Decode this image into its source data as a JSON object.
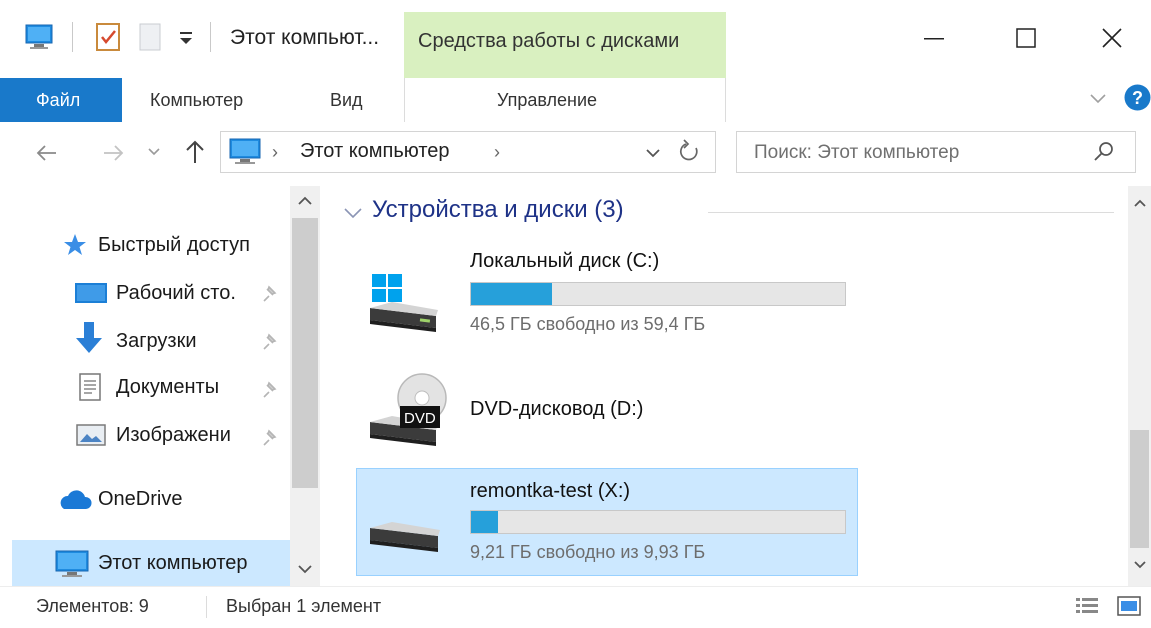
{
  "window": {
    "title": "Этот компьют...",
    "context_tab_title": "Средства работы с дисками"
  },
  "ribbon": {
    "tabs": [
      {
        "label": "Файл",
        "active": true
      },
      {
        "label": "Компьютер"
      },
      {
        "label": "Вид"
      },
      {
        "label": "Управление"
      }
    ]
  },
  "address": {
    "location": "Этот компьютер",
    "search_placeholder": "Поиск: Этот компьютер"
  },
  "nav": {
    "items": [
      {
        "label": "Быстрый доступ",
        "icon": "star-icon"
      },
      {
        "label": "Рабочий сто.",
        "icon": "desktop-icon",
        "pinned": true
      },
      {
        "label": "Загрузки",
        "icon": "download-arrow-icon",
        "pinned": true
      },
      {
        "label": "Документы",
        "icon": "document-icon",
        "pinned": true
      },
      {
        "label": "Изображени",
        "icon": "pictures-icon",
        "pinned": true
      },
      {
        "label": "OneDrive",
        "icon": "cloud-icon"
      },
      {
        "label": "Этот компьютер",
        "icon": "computer-icon",
        "selected": true
      }
    ]
  },
  "content": {
    "group_header": "Устройства и диски (3)",
    "drives": [
      {
        "name": "Локальный диск (C:)",
        "free_text": "46,5 ГБ свободно из 59,4 ГБ",
        "used_fraction": 0.217,
        "icon": "windows-drive-icon"
      },
      {
        "name": "DVD-дисковод (D:)",
        "icon": "dvd-drive-icon",
        "dvd_label": "DVD"
      },
      {
        "name": "remontka-test (X:)",
        "free_text": "9,21 ГБ свободно из 9,93 ГБ",
        "used_fraction": 0.073,
        "icon": "drive-icon",
        "selected": true
      }
    ]
  },
  "status": {
    "count": "Элементов: 9",
    "selection": "Выбран 1 элемент"
  },
  "colors": {
    "file_tab": "#1979ca",
    "context_tab": "#d9f0c0",
    "selection": "#cce8ff",
    "bar_fill": "#26a0da",
    "group_header": "#1e3287"
  }
}
